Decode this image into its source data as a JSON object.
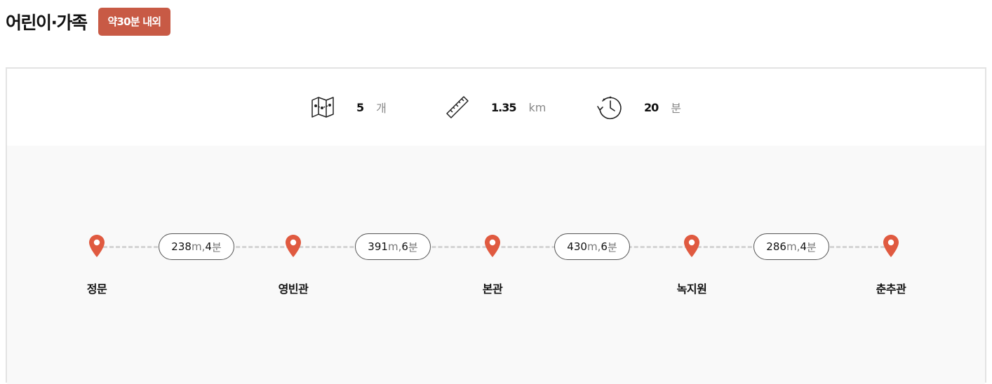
{
  "header": {
    "title": "어린이·가족",
    "badge": "약30분 내외"
  },
  "stats": {
    "count": {
      "icon": "map-icon",
      "value": "5",
      "unit": "개"
    },
    "distance": {
      "icon": "ruler-icon",
      "value": "1.35",
      "unit": "km"
    },
    "time": {
      "icon": "clock-rewind-icon",
      "value": "20",
      "unit": "분"
    }
  },
  "route": {
    "pin_color": "#e05a40",
    "points": [
      "정문",
      "영빈관",
      "본관",
      "녹지원",
      "춘추관"
    ],
    "segments": [
      {
        "dist": "238",
        "dist_unit": "m",
        "sep": ", ",
        "time": "4",
        "time_unit": "분"
      },
      {
        "dist": "391",
        "dist_unit": "m",
        "sep": ", ",
        "time": "6",
        "time_unit": "분"
      },
      {
        "dist": "430",
        "dist_unit": "m",
        "sep": ", ",
        "time": "6",
        "time_unit": "분"
      },
      {
        "dist": "286",
        "dist_unit": "m",
        "sep": ", ",
        "time": "4",
        "time_unit": "분"
      }
    ]
  }
}
